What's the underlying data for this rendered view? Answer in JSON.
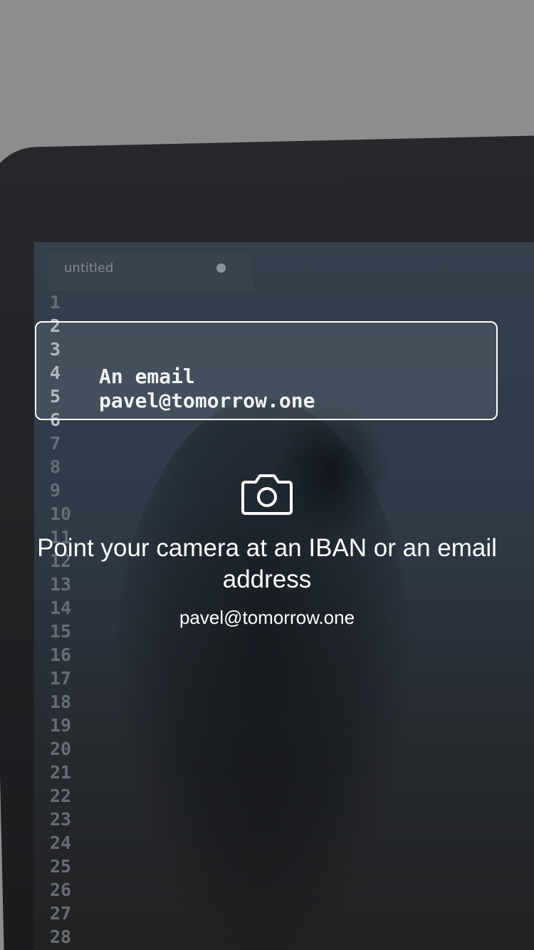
{
  "editor": {
    "tab_title": "untitled",
    "line_numbers": [
      "1",
      "2",
      "3",
      "4",
      "5",
      "6",
      "7",
      "8",
      "9",
      "10",
      "11",
      "12",
      "13",
      "14",
      "15",
      "16",
      "17",
      "18",
      "19",
      "20",
      "21",
      "22",
      "23",
      "24",
      "25",
      "26",
      "27",
      "28"
    ],
    "highlighted_line_numbers": [
      "2",
      "3",
      "4",
      "5",
      "6"
    ],
    "lines": [
      "An email",
      "pavel@tomorrow.one"
    ]
  },
  "scanner": {
    "icon": "camera-icon",
    "instruction": "Point your camera at an IBAN or an email address",
    "detected_value": "pavel@tomorrow.one"
  },
  "colors": {
    "frame_border": "#ffffff",
    "text": "#ffffff",
    "top_background": "#9a9a9a"
  }
}
